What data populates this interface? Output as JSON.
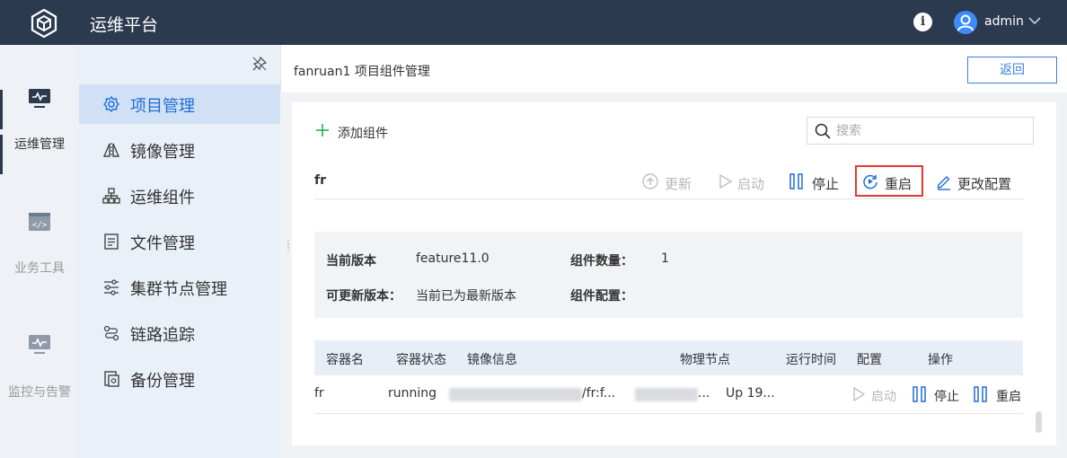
{
  "app": {
    "title": "运维平台",
    "username": "admin"
  },
  "rail": {
    "items": [
      {
        "label": "运维管理",
        "icon": "monitor-icon",
        "active": true
      },
      {
        "label": "业务工具",
        "icon": "code-window-icon",
        "active": false
      },
      {
        "label": "监控与告警",
        "icon": "monitor-pulse-icon",
        "active": false
      }
    ]
  },
  "sidebar": {
    "items": [
      {
        "label": "项目管理",
        "icon": "gear-icon",
        "active": true
      },
      {
        "label": "镜像管理",
        "icon": "mirror-icon"
      },
      {
        "label": "运维组件",
        "icon": "hierarchy-icon"
      },
      {
        "label": "文件管理",
        "icon": "document-icon"
      },
      {
        "label": "集群节点管理",
        "icon": "sliders-icon"
      },
      {
        "label": "链路追踪",
        "icon": "trace-icon"
      },
      {
        "label": "备份管理",
        "icon": "backup-icon"
      }
    ]
  },
  "header": {
    "title": "fanruan1 项目组件管理",
    "back_label": "返回"
  },
  "toolbar": {
    "add_label": "添加组件",
    "search_placeholder": "搜索"
  },
  "component": {
    "name": "fr",
    "actions": {
      "update": "更新",
      "start": "启动",
      "stop": "停止",
      "restart": "重启",
      "config": "更改配置"
    },
    "info": {
      "current_version_label": "当前版本",
      "current_version": "feature11.0",
      "count_label": "组件数量：",
      "count": "1",
      "updatable_label": "可更新版本：",
      "updatable": "当前已为最新版本",
      "config_label": "组件配置："
    }
  },
  "table": {
    "columns": [
      "容器名",
      "容器状态",
      "镜像信息",
      "物理节点",
      "运行时间",
      "配置",
      "操作"
    ],
    "rows": [
      {
        "name": "fr",
        "status": "running",
        "image_suffix": "/fr:f...",
        "node_suffix": "...",
        "uptime": "Up 19...",
        "start": "启动",
        "stop": "停止",
        "restart": "重启"
      }
    ]
  },
  "colors": {
    "topbar": "#2b3a4f",
    "accent": "#1e6dd8",
    "highlight": "#e53935"
  }
}
